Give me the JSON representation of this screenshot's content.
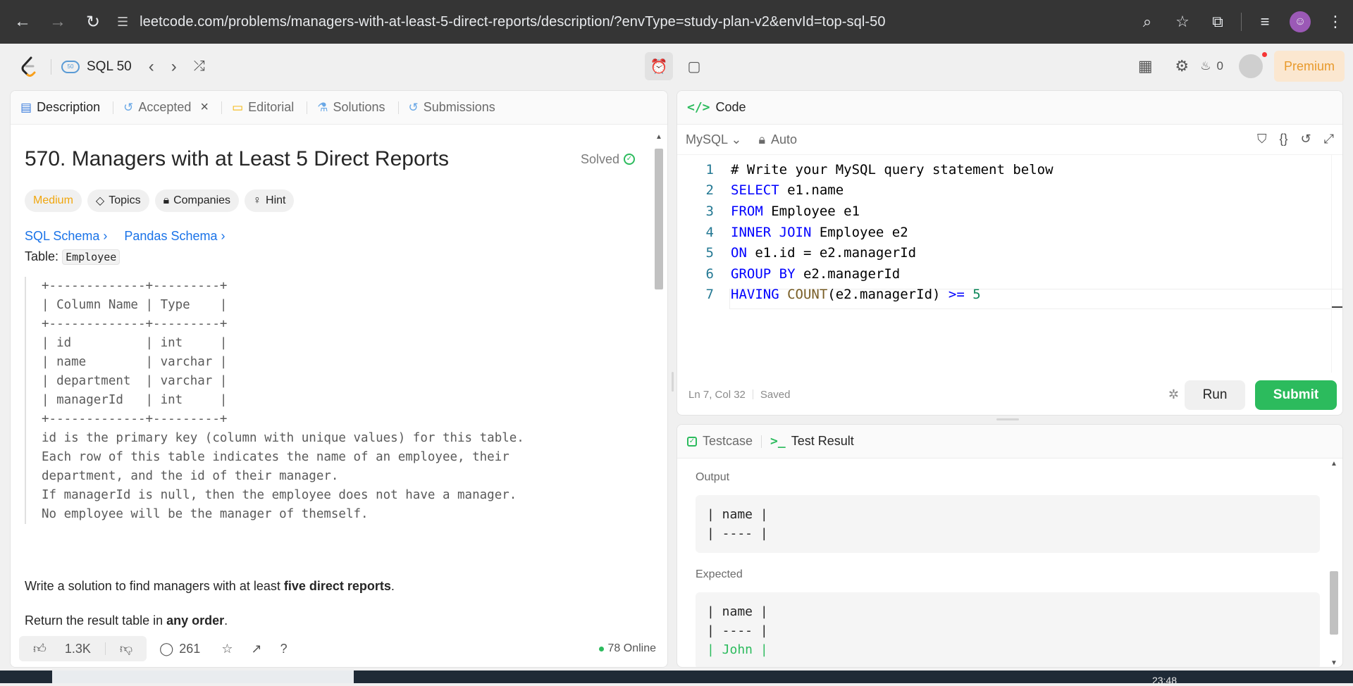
{
  "browser": {
    "url": "leetcode.com/problems/managers-with-at-least-5-direct-reports/description/?envType=study-plan-v2&envId=top-sql-50"
  },
  "header": {
    "list_name": "SQL 50",
    "streak_count": "0",
    "premium_label": "Premium"
  },
  "tabs": [
    {
      "label": "Description"
    },
    {
      "label": "Accepted"
    },
    {
      "label": "Editorial"
    },
    {
      "label": "Solutions"
    },
    {
      "label": "Submissions"
    }
  ],
  "problem": {
    "title": "570. Managers with at Least 5 Direct Reports",
    "status": "Solved",
    "difficulty": "Medium",
    "chips": [
      "Topics",
      "Companies",
      "Hint"
    ],
    "schema_links": [
      "SQL Schema",
      "Pandas Schema"
    ],
    "table_label": "Table:",
    "table_name": "Employee",
    "schema_text": "+-------------+---------+\n| Column Name | Type    |\n+-------------+---------+\n| id          | int     |\n| name        | varchar |\n| department  | varchar |\n| managerId   | int     |\n+-------------+---------+\nid is the primary key (column with unique values) for this table.\nEach row of this table indicates the name of an employee, their\ndepartment, and the id of their manager.\nIf managerId is null, then the employee does not have a manager.\nNo employee will be the manager of themself.",
    "para1_before": "Write a solution to find managers with at least ",
    "para1_bold": "five direct reports",
    "para1_after": ".",
    "para2_before": "Return the result table in ",
    "para2_bold": "any order",
    "para2_after": "."
  },
  "footer": {
    "likes": "1.3K",
    "comments": "261",
    "online": "78 Online"
  },
  "code_panel": {
    "title": "Code",
    "language": "MySQL",
    "mode": "Auto",
    "lines": [
      {
        "n": "1",
        "text": "# Write your MySQL query statement below"
      },
      {
        "n": "2",
        "text": "SELECT e1.name"
      },
      {
        "n": "3",
        "text": "FROM Employee e1"
      },
      {
        "n": "4",
        "text": "INNER JOIN Employee e2"
      },
      {
        "n": "5",
        "text": "ON e1.id = e2.managerId"
      },
      {
        "n": "6",
        "text": "GROUP BY e2.managerId"
      },
      {
        "n": "7",
        "text": "HAVING COUNT(e2.managerId) >= 5"
      }
    ],
    "cursor_position": "Ln 7, Col 32",
    "save_status": "Saved",
    "run_label": "Run",
    "submit_label": "Submit"
  },
  "result_panel": {
    "testcase_label": "Testcase",
    "result_label": "Test Result",
    "output_label": "Output",
    "output_lines": [
      "| name |",
      "| ---- |"
    ],
    "expected_label": "Expected",
    "expected_lines": [
      "| name |",
      "| ---- |",
      "| John |"
    ]
  },
  "taskbar": {
    "clock": "23:48"
  },
  "colors": {
    "accent_green": "#2cbb5d",
    "medium_orange": "#f0a60d",
    "link_blue": "#1a73e8",
    "premium_text": "#e89a2c"
  }
}
